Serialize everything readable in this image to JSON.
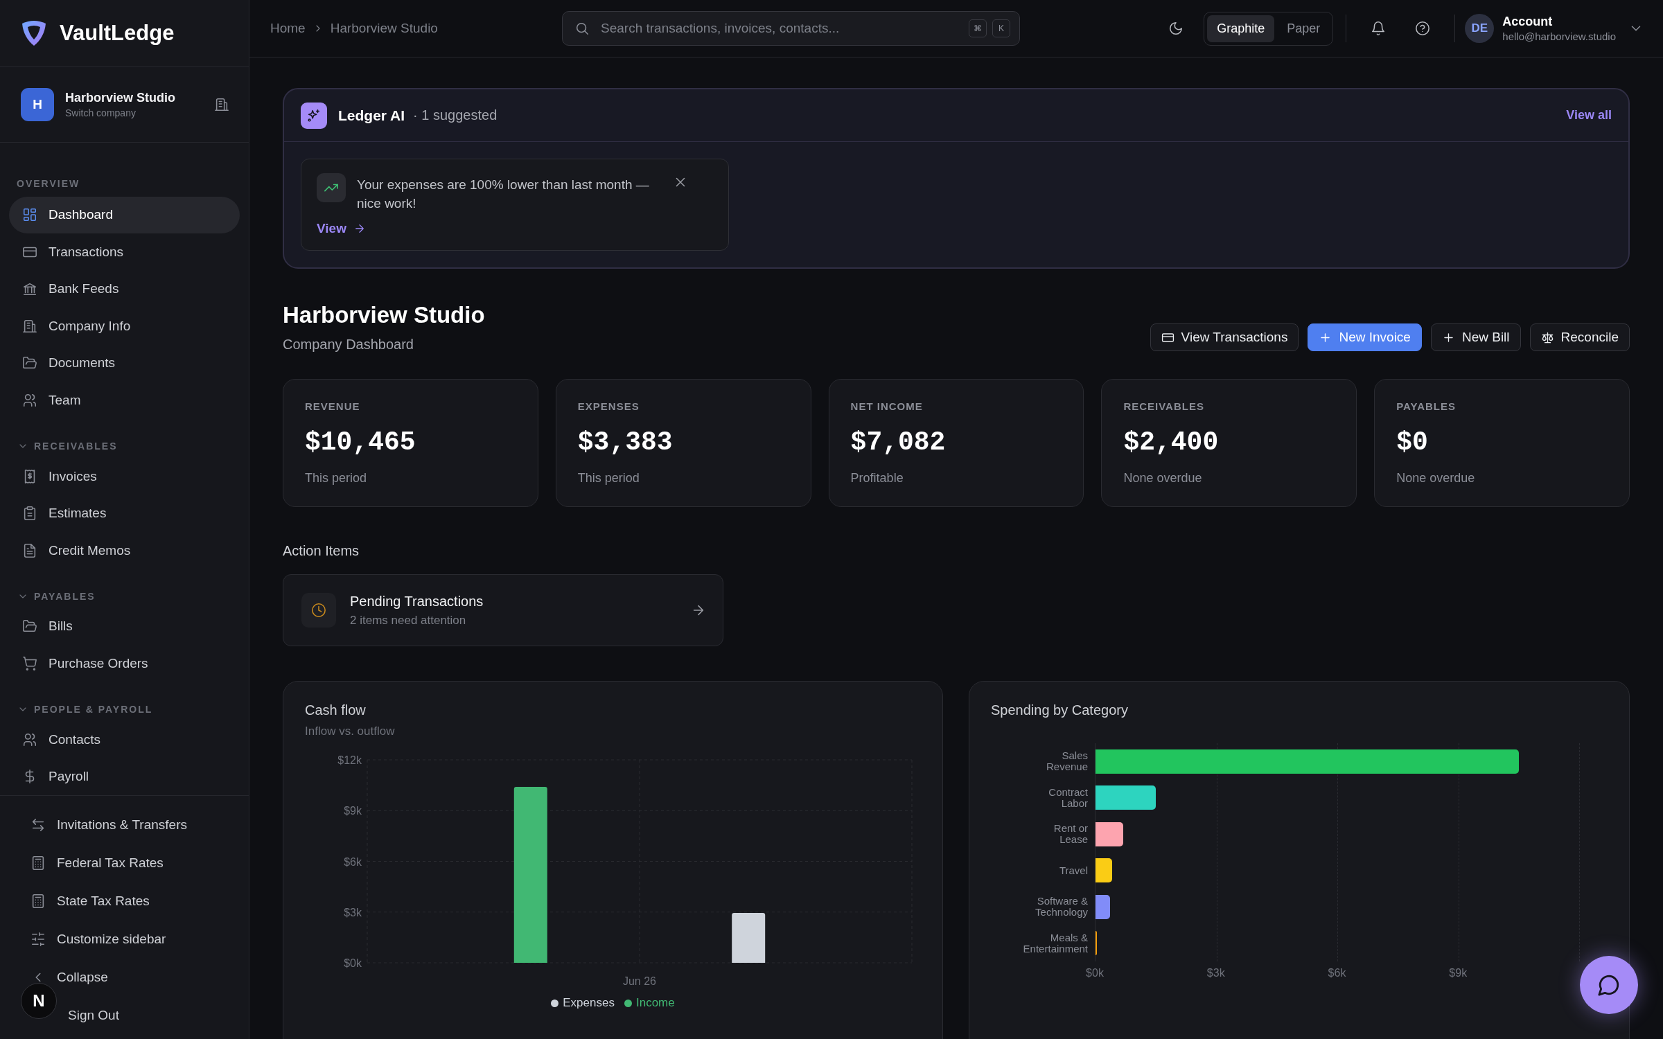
{
  "brand": {
    "name": "VaultLedge"
  },
  "company": {
    "name": "Harborview Studio",
    "subtitle": "Switch company",
    "initial": "H"
  },
  "sidebar": {
    "sections": [
      {
        "label": "OVERVIEW",
        "kind": "static",
        "items": [
          {
            "label": "Dashboard",
            "selected": true
          },
          {
            "label": "Transactions",
            "selected": false
          },
          {
            "label": "Bank Feeds",
            "selected": false
          },
          {
            "label": "Company Info",
            "selected": false
          },
          {
            "label": "Documents",
            "selected": false
          },
          {
            "label": "Team",
            "selected": false
          }
        ]
      },
      {
        "label": "RECEIVABLES",
        "kind": "collapsible",
        "expanded": true,
        "items": [
          {
            "label": "Invoices",
            "selected": false
          },
          {
            "label": "Estimates",
            "selected": false
          },
          {
            "label": "Credit Memos",
            "selected": false
          }
        ]
      },
      {
        "label": "PAYABLES",
        "kind": "collapsible",
        "expanded": true,
        "items": [
          {
            "label": "Bills",
            "selected": false
          },
          {
            "label": "Purchase Orders",
            "selected": false
          }
        ]
      },
      {
        "label": "PEOPLE & PAYROLL",
        "kind": "collapsible",
        "expanded": true,
        "items": [
          {
            "label": "Contacts",
            "selected": false
          },
          {
            "label": "Payroll",
            "selected": false
          }
        ]
      }
    ],
    "footer_items": [
      {
        "label": "Invitations & Transfers"
      },
      {
        "label": "Federal Tax Rates"
      },
      {
        "label": "State Tax Rates"
      },
      {
        "label": "Customize sidebar"
      },
      {
        "label": "Collapse"
      },
      {
        "label": "Sign Out"
      }
    ]
  },
  "dev_indicator": {
    "label": "N"
  },
  "breadcrumbs": [
    {
      "label": "Home"
    },
    {
      "label": "Harborview Studio"
    }
  ],
  "search": {
    "placeholder": "Search transactions, invoices, contacts...",
    "shortcut": [
      "⌘",
      "K"
    ]
  },
  "theme_switch": [
    {
      "label": "Graphite",
      "selected": true
    },
    {
      "label": "Paper",
      "selected": false
    }
  ],
  "account": {
    "initials": "DE",
    "name": "Account",
    "email": "hello@harborview.studio"
  },
  "ai_panel": {
    "title": "Ledger AI",
    "count": "· 1 suggested",
    "action": "View all",
    "suggestions": [
      {
        "text": "Your expenses are 100% lower than last month — nice work!",
        "link": "View"
      }
    ]
  },
  "page": {
    "title": "Harborview Studio",
    "subtitle": "Company Dashboard"
  },
  "actions": [
    {
      "label": "View Transactions",
      "kind": "secondary"
    },
    {
      "label": "New Invoice",
      "kind": "primary"
    },
    {
      "label": "New Bill",
      "kind": "secondary"
    },
    {
      "label": "Reconcile",
      "kind": "secondary"
    }
  ],
  "stats": [
    {
      "label": "REVENUE",
      "value": "$10,465",
      "note": "This period"
    },
    {
      "label": "EXPENSES",
      "value": "$3,383",
      "note": "This period"
    },
    {
      "label": "NET INCOME",
      "value": "$7,082",
      "note": "Profitable"
    },
    {
      "label": "RECEIVABLES",
      "value": "$2,400",
      "note": "None overdue"
    },
    {
      "label": "PAYABLES",
      "value": "$0",
      "note": "None overdue"
    }
  ],
  "action_items": {
    "title": "Action Items",
    "items": [
      {
        "title": "Pending Transactions",
        "subtitle": "2 items need attention"
      }
    ]
  },
  "cash_flow": {
    "subtitle": "Inflow vs. outflow",
    "chart_data": {
      "type": "bar",
      "title": "Cash flow",
      "categories": [
        "Jun 26"
      ],
      "series": [
        {
          "name": "Income",
          "color": "#41b873",
          "values": [
            10400
          ]
        },
        {
          "name": "Expenses",
          "color": "#cfd4dc",
          "values": [
            2950
          ]
        }
      ],
      "grid": true,
      "ylim": [
        0,
        12000
      ],
      "yticks": [
        {
          "value": 0,
          "label": "$0k"
        },
        {
          "value": 3000,
          "label": "$3k"
        },
        {
          "value": 6000,
          "label": "$6k"
        },
        {
          "value": 9000,
          "label": "$9k"
        },
        {
          "value": 12000,
          "label": "$12k"
        }
      ]
    }
  },
  "spending": {
    "chart_data": {
      "type": "bar",
      "orientation": "horizontal",
      "title": "Spending by Category",
      "categories": [
        "Sales Revenue",
        "Contract Labor",
        "Rent or Lease",
        "Travel",
        "Software & Technology",
        "Meals & Entertainment"
      ],
      "values": [
        10500,
        1500,
        680,
        420,
        360,
        40
      ],
      "grid": true,
      "colors": [
        "#22c55e",
        "#2dd4bf",
        "#fda4af",
        "#facc15",
        "#818cf8",
        "#f59e0b"
      ],
      "xlim": [
        0,
        12000
      ],
      "xticks": [
        {
          "value": 0,
          "label": "$0k"
        },
        {
          "value": 3000,
          "label": "$3k"
        },
        {
          "value": 6000,
          "label": "$6k"
        },
        {
          "value": 9000,
          "label": "$9k"
        }
      ]
    }
  }
}
